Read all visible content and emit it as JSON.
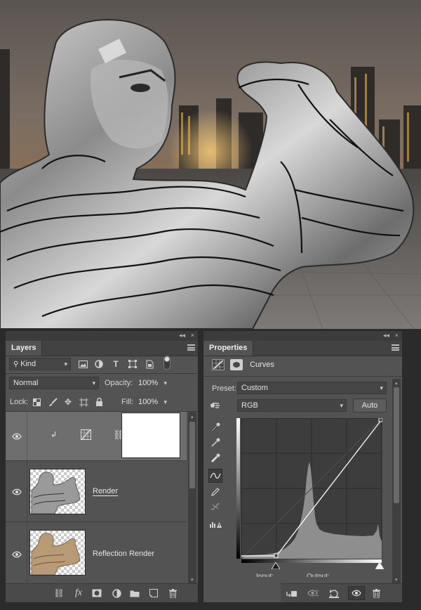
{
  "layers_panel": {
    "tab_label": "Layers",
    "collapse_label": "◂◂",
    "close_label": "×",
    "filter_kind": "Kind",
    "blend_mode": "Normal",
    "opacity_label": "Opacity:",
    "opacity_value": "100%",
    "lock_label": "Lock:",
    "fill_label": "Fill:",
    "fill_value": "100%",
    "layers": [
      {
        "name": "",
        "type": "curves-adjustment",
        "selected": true,
        "visible": true
      },
      {
        "name": "Render",
        "type": "pixel",
        "selected": false,
        "visible": true
      },
      {
        "name": "Reflection Render",
        "type": "pixel",
        "selected": false,
        "visible": true
      }
    ],
    "bottom_icons": [
      "link-icon",
      "fx-icon",
      "mask-icon",
      "adjustment-icon",
      "folder-icon",
      "new-layer-icon",
      "trash-icon"
    ]
  },
  "properties_panel": {
    "tab_label": "Properties",
    "collapse_label": "◂◂",
    "close_label": "×",
    "adjustment_title": "Curves",
    "preset_label": "Preset:",
    "preset_value": "Custom",
    "channel_value": "RGB",
    "auto_label": "Auto",
    "input_label": "Input:",
    "output_label": "Output:",
    "curve_points": [
      [
        0,
        0
      ],
      [
        255,
        255
      ]
    ],
    "bottom_icons": [
      "clip-icon",
      "view-previous-icon",
      "reset-icon",
      "visibility-icon",
      "trash-icon"
    ]
  },
  "colors": {
    "panel_bg": "#535353",
    "selected_row": "#6e6e6e",
    "graph_bg": "#3d3d3d"
  }
}
